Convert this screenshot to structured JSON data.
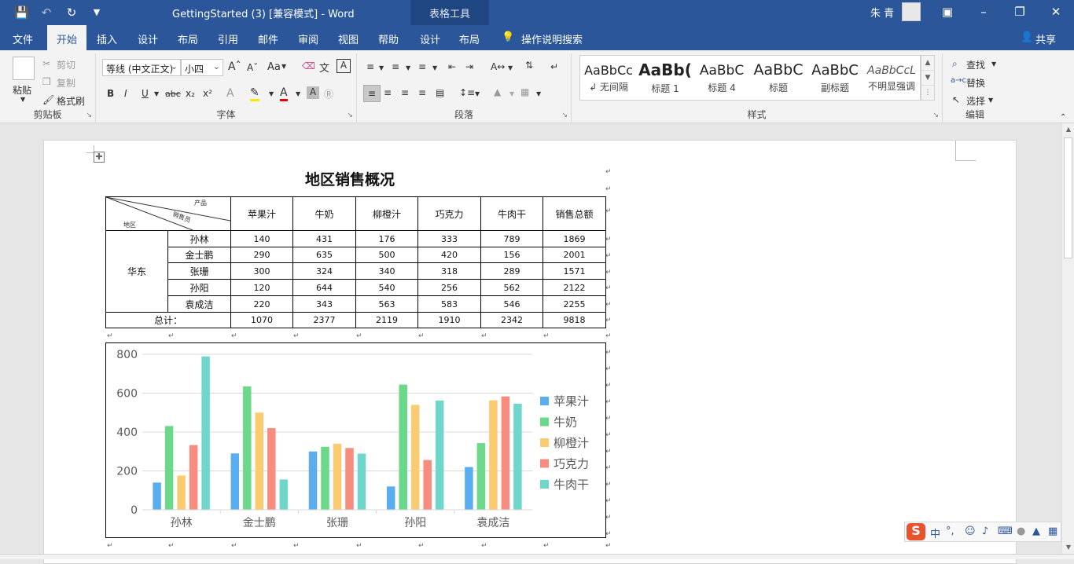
{
  "window": {
    "doc_title": "GettingStarted (3) [兼容模式]  -  Word",
    "context_group": "表格工具",
    "user": "朱 青"
  },
  "tabs": [
    "文件",
    "开始",
    "插入",
    "设计",
    "布局",
    "引用",
    "邮件",
    "审阅",
    "视图",
    "帮助"
  ],
  "context_tabs": [
    "设计",
    "布局"
  ],
  "tell_me": "操作说明搜索",
  "share": "共享",
  "ribbon": {
    "clipboard": {
      "label": "剪贴板",
      "paste": "粘贴",
      "cut": "剪切",
      "copy": "复制",
      "format_painter": "格式刷"
    },
    "font": {
      "label": "字体",
      "font_name": "等线 (中文正文)",
      "font_size": "小四",
      "aa": "Aa"
    },
    "paragraph": {
      "label": "段落"
    },
    "styles": {
      "label": "样式",
      "items": [
        {
          "sample": "AaBbCc",
          "name": "↲ 无间隔"
        },
        {
          "sample": "AaBb(",
          "name": "标题 1"
        },
        {
          "sample": "AaBbC",
          "name": "标题 4"
        },
        {
          "sample": "AaBbC",
          "name": "标题"
        },
        {
          "sample": "AaBbC",
          "name": "副标题"
        },
        {
          "sample": "AaBbCcL",
          "name": "不明显强调"
        }
      ]
    },
    "editing": {
      "label": "编辑",
      "find": "查找",
      "replace": "替换",
      "select": "选择"
    }
  },
  "document": {
    "heading": "地区销售概况",
    "table": {
      "corner": {
        "product": "产品",
        "salesperson": "销售员",
        "region": "地区"
      },
      "headers": [
        "苹果汁",
        "牛奶",
        "柳橙汁",
        "巧克力",
        "牛肉干",
        "销售总额"
      ],
      "region": "华东",
      "rows": [
        {
          "name": "孙林",
          "values": [
            "140",
            "431",
            "176",
            "333",
            "789",
            "1869"
          ]
        },
        {
          "name": "金士鹏",
          "values": [
            "290",
            "635",
            "500",
            "420",
            "156",
            "2001"
          ]
        },
        {
          "name": "张珊",
          "values": [
            "300",
            "324",
            "340",
            "318",
            "289",
            "1571"
          ]
        },
        {
          "name": "孙阳",
          "values": [
            "120",
            "644",
            "540",
            "256",
            "562",
            "2122"
          ]
        },
        {
          "name": "袁成洁",
          "values": [
            "220",
            "343",
            "563",
            "583",
            "546",
            "2255"
          ]
        }
      ],
      "total_label": "总计：",
      "totals": [
        "1070",
        "2377",
        "2119",
        "1910",
        "2342",
        "9818"
      ]
    }
  },
  "chart_data": {
    "type": "bar",
    "categories": [
      "孙林",
      "金士鹏",
      "张珊",
      "孙阳",
      "袁成洁"
    ],
    "series": [
      {
        "name": "苹果汁",
        "color": "#5aaef0",
        "values": [
          140,
          290,
          300,
          120,
          220
        ]
      },
      {
        "name": "牛奶",
        "color": "#6cd98a",
        "values": [
          431,
          635,
          324,
          644,
          343
        ]
      },
      {
        "name": "柳橙汁",
        "color": "#fbcb72",
        "values": [
          176,
          500,
          340,
          540,
          563
        ]
      },
      {
        "name": "巧克力",
        "color": "#f78c7f",
        "values": [
          333,
          420,
          318,
          256,
          583
        ]
      },
      {
        "name": "牛肉干",
        "color": "#6fd6cb",
        "values": [
          789,
          156,
          289,
          562,
          546
        ]
      }
    ],
    "ylim": [
      0,
      800
    ],
    "yticks": [
      0,
      200,
      400,
      600,
      800
    ],
    "grid": true,
    "legend": "right",
    "title": "",
    "xlabel": "",
    "ylabel": ""
  }
}
